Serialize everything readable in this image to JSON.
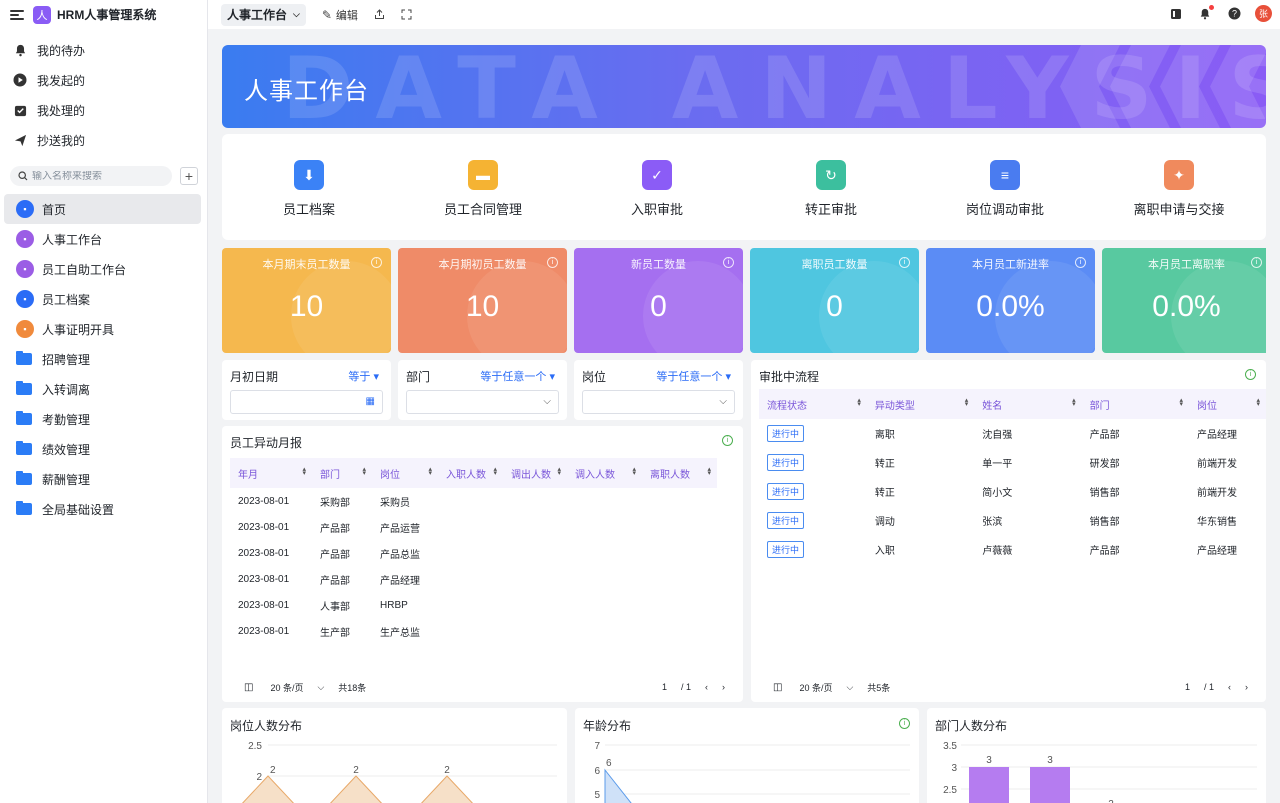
{
  "app": {
    "name": "HRM人事管理系统",
    "logo_char": "人"
  },
  "quick_items": [
    {
      "label": "我的待办",
      "icon": "bell-icon"
    },
    {
      "label": "我发起的",
      "icon": "play-icon"
    },
    {
      "label": "我处理的",
      "icon": "inbox-icon"
    },
    {
      "label": "抄送我的",
      "icon": "send-icon"
    }
  ],
  "search": {
    "placeholder": "输入名称来搜索"
  },
  "nav": [
    {
      "label": "首页",
      "icon": "home-icon",
      "color": "#2b6cf6",
      "active": true
    },
    {
      "label": "人事工作台",
      "icon": "workbench-icon",
      "color": "#9b5de5"
    },
    {
      "label": "员工自助工作台",
      "icon": "self-service-icon",
      "color": "#9b5de5"
    },
    {
      "label": "员工档案",
      "icon": "file-icon",
      "color": "#2b6cf6"
    },
    {
      "label": "人事证明开具",
      "icon": "certificate-icon",
      "color": "#f08a3c"
    },
    {
      "label": "招聘管理",
      "icon": "folder-icon",
      "folder": true
    },
    {
      "label": "入转调离",
      "icon": "folder-icon",
      "folder": true
    },
    {
      "label": "考勤管理",
      "icon": "folder-icon",
      "folder": true
    },
    {
      "label": "绩效管理",
      "icon": "folder-icon",
      "folder": true
    },
    {
      "label": "薪酬管理",
      "icon": "folder-icon",
      "folder": true
    },
    {
      "label": "全局基础设置",
      "icon": "folder-icon",
      "folder": true
    }
  ],
  "topbar": {
    "tab": "人事工作台",
    "edit": "编辑",
    "avatar": "张"
  },
  "banner": {
    "title": "人事工作台",
    "bg_text": "DATA ANALYSIS"
  },
  "shortcuts": [
    {
      "label": "员工档案",
      "icon": "employee-file-icon",
      "color": "#3b82f6"
    },
    {
      "label": "员工合同管理",
      "icon": "contract-icon",
      "color": "#f5b333"
    },
    {
      "label": "入职审批",
      "icon": "shield-check-icon",
      "color": "#8b5cf6"
    },
    {
      "label": "转正审批",
      "icon": "bookmark-icon",
      "color": "#3cbf9e"
    },
    {
      "label": "岗位调动审批",
      "icon": "document-icon",
      "color": "#4a7cf0"
    },
    {
      "label": "离职申请与交接",
      "icon": "user-leave-icon",
      "color": "#f08a5d"
    }
  ],
  "kpis": [
    {
      "title": "本月期末员工数量",
      "value": "10",
      "color": "#f5b84e"
    },
    {
      "title": "本月期初员工数量",
      "value": "10",
      "color": "#ef8b68"
    },
    {
      "title": "新员工数量",
      "value": "0",
      "color": "#a56ff0"
    },
    {
      "title": "离职员工数量",
      "value": "0",
      "color": "#4fc6e0"
    },
    {
      "title": "本月员工新进率",
      "value": "0.0%",
      "color": "#5b8cf5"
    },
    {
      "title": "本月员工离职率",
      "value": "0.0%",
      "color": "#58c9a0"
    }
  ],
  "filters": [
    {
      "label": "月初日期",
      "op": "等于",
      "type": "date"
    },
    {
      "label": "部门",
      "op": "等于任意一个",
      "type": "select"
    },
    {
      "label": "岗位",
      "op": "等于任意一个",
      "type": "select"
    }
  ],
  "monthly": {
    "title": "员工异动月报",
    "columns": [
      "年月",
      "部门",
      "岗位",
      "入职人数",
      "调出人数",
      "调入人数",
      "离职人数"
    ],
    "rows": [
      [
        "2023-08-01",
        "采购部",
        "采购员"
      ],
      [
        "2023-08-01",
        "产品部",
        "产品运营"
      ],
      [
        "2023-08-01",
        "产品部",
        "产品总监"
      ],
      [
        "2023-08-01",
        "产品部",
        "产品经理"
      ],
      [
        "2023-08-01",
        "人事部",
        "HRBP"
      ],
      [
        "2023-08-01",
        "生产部",
        "生产总监"
      ]
    ],
    "page_size": "20 条/页",
    "total": "共18条",
    "page": "1",
    "pages": "/ 1"
  },
  "approvals": {
    "title": "审批中流程",
    "columns": [
      "流程状态",
      "异动类型",
      "姓名",
      "部门",
      "岗位"
    ],
    "rows": [
      [
        "进行中",
        "离职",
        "沈自强",
        "产品部",
        "产品经理"
      ],
      [
        "进行中",
        "转正",
        "单一平",
        "研发部",
        "前端开发"
      ],
      [
        "进行中",
        "转正",
        "简小文",
        "销售部",
        "前端开发"
      ],
      [
        "进行中",
        "调动",
        "张滨",
        "销售部",
        "华东销售"
      ],
      [
        "进行中",
        "入职",
        "卢薇薇",
        "产品部",
        "产品经理"
      ]
    ],
    "page_size": "20 条/页",
    "total": "共5条",
    "page": "1",
    "pages": "/ 1"
  },
  "charts": [
    {
      "title": "岗位人数分布",
      "chart_data": {
        "type": "area",
        "yticks": [
          "2.5",
          "2"
        ],
        "point_labels": [
          "2",
          "2",
          "2"
        ]
      }
    },
    {
      "title": "年龄分布",
      "chart_data": {
        "type": "area",
        "yticks": [
          "7",
          "6",
          "5"
        ],
        "point_labels": [
          "6"
        ]
      }
    },
    {
      "title": "部门人数分布",
      "chart_data": {
        "type": "bar",
        "yticks": [
          "3.5",
          "3",
          "2.5"
        ],
        "values": [
          3,
          3,
          2
        ],
        "labels": [
          "3",
          "3",
          "2"
        ]
      }
    }
  ]
}
